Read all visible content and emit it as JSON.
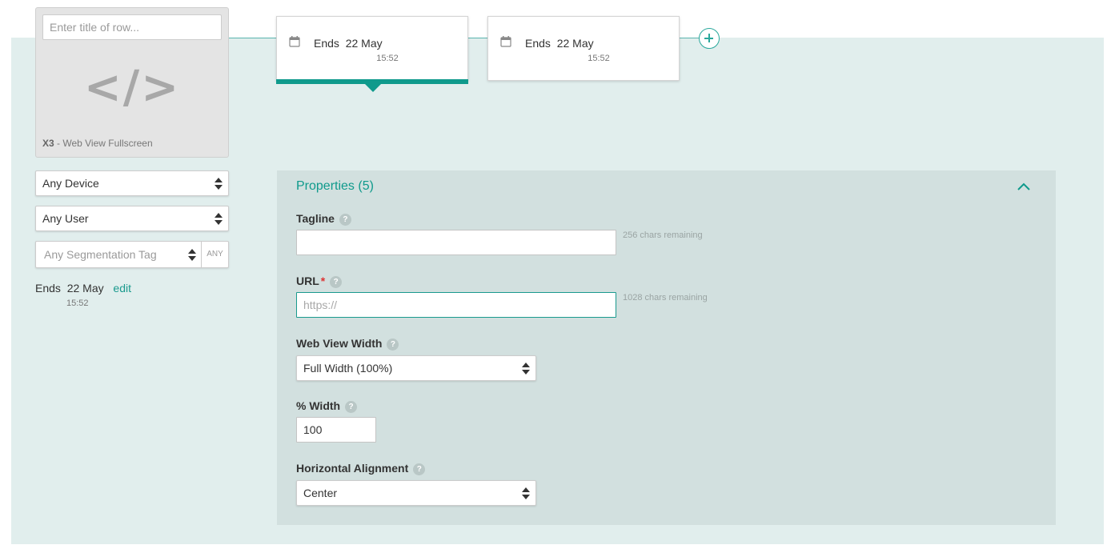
{
  "row": {
    "title_placeholder": "Enter title of row...",
    "glyph": "</>",
    "type_code": "X3",
    "type_name": " - Web View Fullscreen"
  },
  "filters": {
    "device": "Any Device",
    "user": "Any User",
    "segmentation_placeholder": "Any Segmentation Tag",
    "segmentation_any": "ANY"
  },
  "schedule_summary": {
    "ends_label": "Ends",
    "date": "22 May",
    "edit_label": "edit",
    "time": "15:52"
  },
  "schedules": [
    {
      "label": "Ends",
      "date": "22 May",
      "time": "15:52",
      "active": true
    },
    {
      "label": "Ends",
      "date": "22 May",
      "time": "15:52",
      "active": false
    }
  ],
  "properties": {
    "title": "Properties (5)",
    "tagline": {
      "label": "Tagline",
      "value": "",
      "chars_remaining": "256 chars remaining"
    },
    "url": {
      "label": "URL",
      "required_mark": "*",
      "placeholder": "https://",
      "value": "",
      "chars_remaining": "1028 chars remaining"
    },
    "web_view_width": {
      "label": "Web View Width",
      "value": "Full Width (100%)"
    },
    "percent_width": {
      "label": "% Width",
      "value": "100"
    },
    "horizontal_alignment": {
      "label": "Horizontal Alignment",
      "value": "Center"
    },
    "help_glyph": "?"
  },
  "colors": {
    "accent": "#0f9a8c",
    "stage_bg": "#e1eeed",
    "panel_bg": "#d2e0df"
  }
}
